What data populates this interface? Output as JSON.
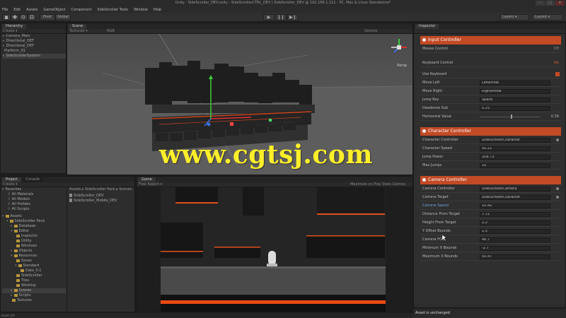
{
  "window": {
    "title": "Unity - SideScroller_DEV.unity - SideScrollerCTRL_DEV | SideScroller_DEV @ 192.168.1.111 - PC, Mac & Linux Standalone*",
    "controls": [
      "–",
      "□",
      "×"
    ]
  },
  "menu": [
    "File",
    "Edit",
    "Assets",
    "GameObject",
    "Component",
    "SideScroller Tools",
    "Window",
    "Help"
  ],
  "toolbar": {
    "pivot_label": "Pivot",
    "global_label": "Global",
    "play": [
      "▶",
      "❙❙",
      "▶❙"
    ],
    "layers_label": "Layers",
    "layout_label": "Layout"
  },
  "hierarchy": {
    "tab": "Hierarchy",
    "create_label": "Create",
    "items": [
      {
        "label": "Camera_Main"
      },
      {
        "label": "Directional_DEF"
      },
      {
        "label": "Directional_DEF"
      },
      {
        "label": "Platform_01"
      },
      {
        "label": "SideScrollerSystem"
      }
    ]
  },
  "scene": {
    "tab": "Scene",
    "shading_label": "Textured",
    "rgb_label": "RGB",
    "gizmos_label": "Gizmos",
    "persp_label": "Persp"
  },
  "project": {
    "tabs": [
      "Project",
      "Console"
    ],
    "create_label": "Create",
    "favorites_label": "Favorites",
    "favorites": [
      "All Materials",
      "All Models",
      "All Prefabs",
      "All Scripts"
    ],
    "assets_label": "Assets",
    "tree": [
      {
        "label": "SideScroller Pack",
        "depth": 1
      },
      {
        "label": "Database",
        "depth": 2
      },
      {
        "label": "Editor",
        "depth": 2
      },
      {
        "label": "Inspector",
        "depth": 3
      },
      {
        "label": "Utility",
        "depth": 3
      },
      {
        "label": "Windows",
        "depth": 3
      },
      {
        "label": "Objects",
        "depth": 2
      },
      {
        "label": "Resources",
        "depth": 2
      },
      {
        "label": "Saves",
        "depth": 3
      },
      {
        "label": "Standard",
        "depth": 3
      },
      {
        "label": "Data_0.1",
        "depth": 4
      },
      {
        "label": "SideScroller",
        "depth": 3
      },
      {
        "label": "Tiles",
        "depth": 3
      },
      {
        "label": "Working",
        "depth": 3
      },
      {
        "label": "Scenes",
        "depth": 2
      },
      {
        "label": "Scripts",
        "depth": 2
      },
      {
        "label": "Textures",
        "depth": 2
      }
    ],
    "breadcrumb": "Assets ▸ SideScroller Pack ▸ Scenes",
    "files": [
      "SideScroller_DEV",
      "SideScroller_Mobile_DEV"
    ],
    "status": "Assets.unity"
  },
  "game": {
    "tab": "Game",
    "aspect_label": "Free Aspect",
    "options_label": "Maximize on Play   Stats   Gizmos"
  },
  "inspector": {
    "tab": "Inspector",
    "sections": [
      {
        "title": "Input Controller",
        "rows": [
          {
            "label": "Mouse Control",
            "toggle": "Off"
          },
          {
            "label": "Keyboard Control",
            "toggle": "On",
            "on": true
          },
          {
            "label": "Use Keyboard",
            "value": "",
            "orange": true
          },
          {
            "label": "Move Left",
            "value": "LeftArrow"
          },
          {
            "label": "Move Right",
            "value": "RightArrow"
          },
          {
            "label": "Jump Key",
            "value": "Space"
          },
          {
            "label": "Deadzone Sub",
            "value": "0.25"
          },
          {
            "label": "Horizontal Value",
            "slider": "0.39"
          }
        ]
      },
      {
        "title": "Character Controller",
        "rows": [
          {
            "label": "Character Controller",
            "value": "SideScrollerCharacter",
            "picker": true
          },
          {
            "label": "Character Speed",
            "value": "50.21"
          },
          {
            "label": "Jump Power",
            "value": "208.73"
          },
          {
            "label": "Max Jumps",
            "value": "10"
          }
        ]
      },
      {
        "title": "Camera Controller",
        "rows": [
          {
            "label": "Camera Controller",
            "value": "SideScrollerCamera",
            "picker": true
          },
          {
            "label": "Camera Target",
            "value": "SideScrollerCharacter",
            "picker": true
          },
          {
            "label": "Camera Speed",
            "value": "10.42",
            "blue": true
          },
          {
            "label": "Distance From Target",
            "value": "7.72"
          },
          {
            "label": "Height From Target",
            "value": "2.2"
          },
          {
            "label": "Y Offset Bounds",
            "value": "1.5"
          },
          {
            "label": "Camera FOV",
            "value": "46.7"
          },
          {
            "label": "Minimum X Bounds",
            "value": "-2.7"
          },
          {
            "label": "Maximum X Bounds",
            "value": "50.47"
          }
        ]
      }
    ],
    "footer": "Asset is unchanged"
  },
  "status_bar": "Asset 3.0",
  "watermark": "www.cgtsj.com"
}
